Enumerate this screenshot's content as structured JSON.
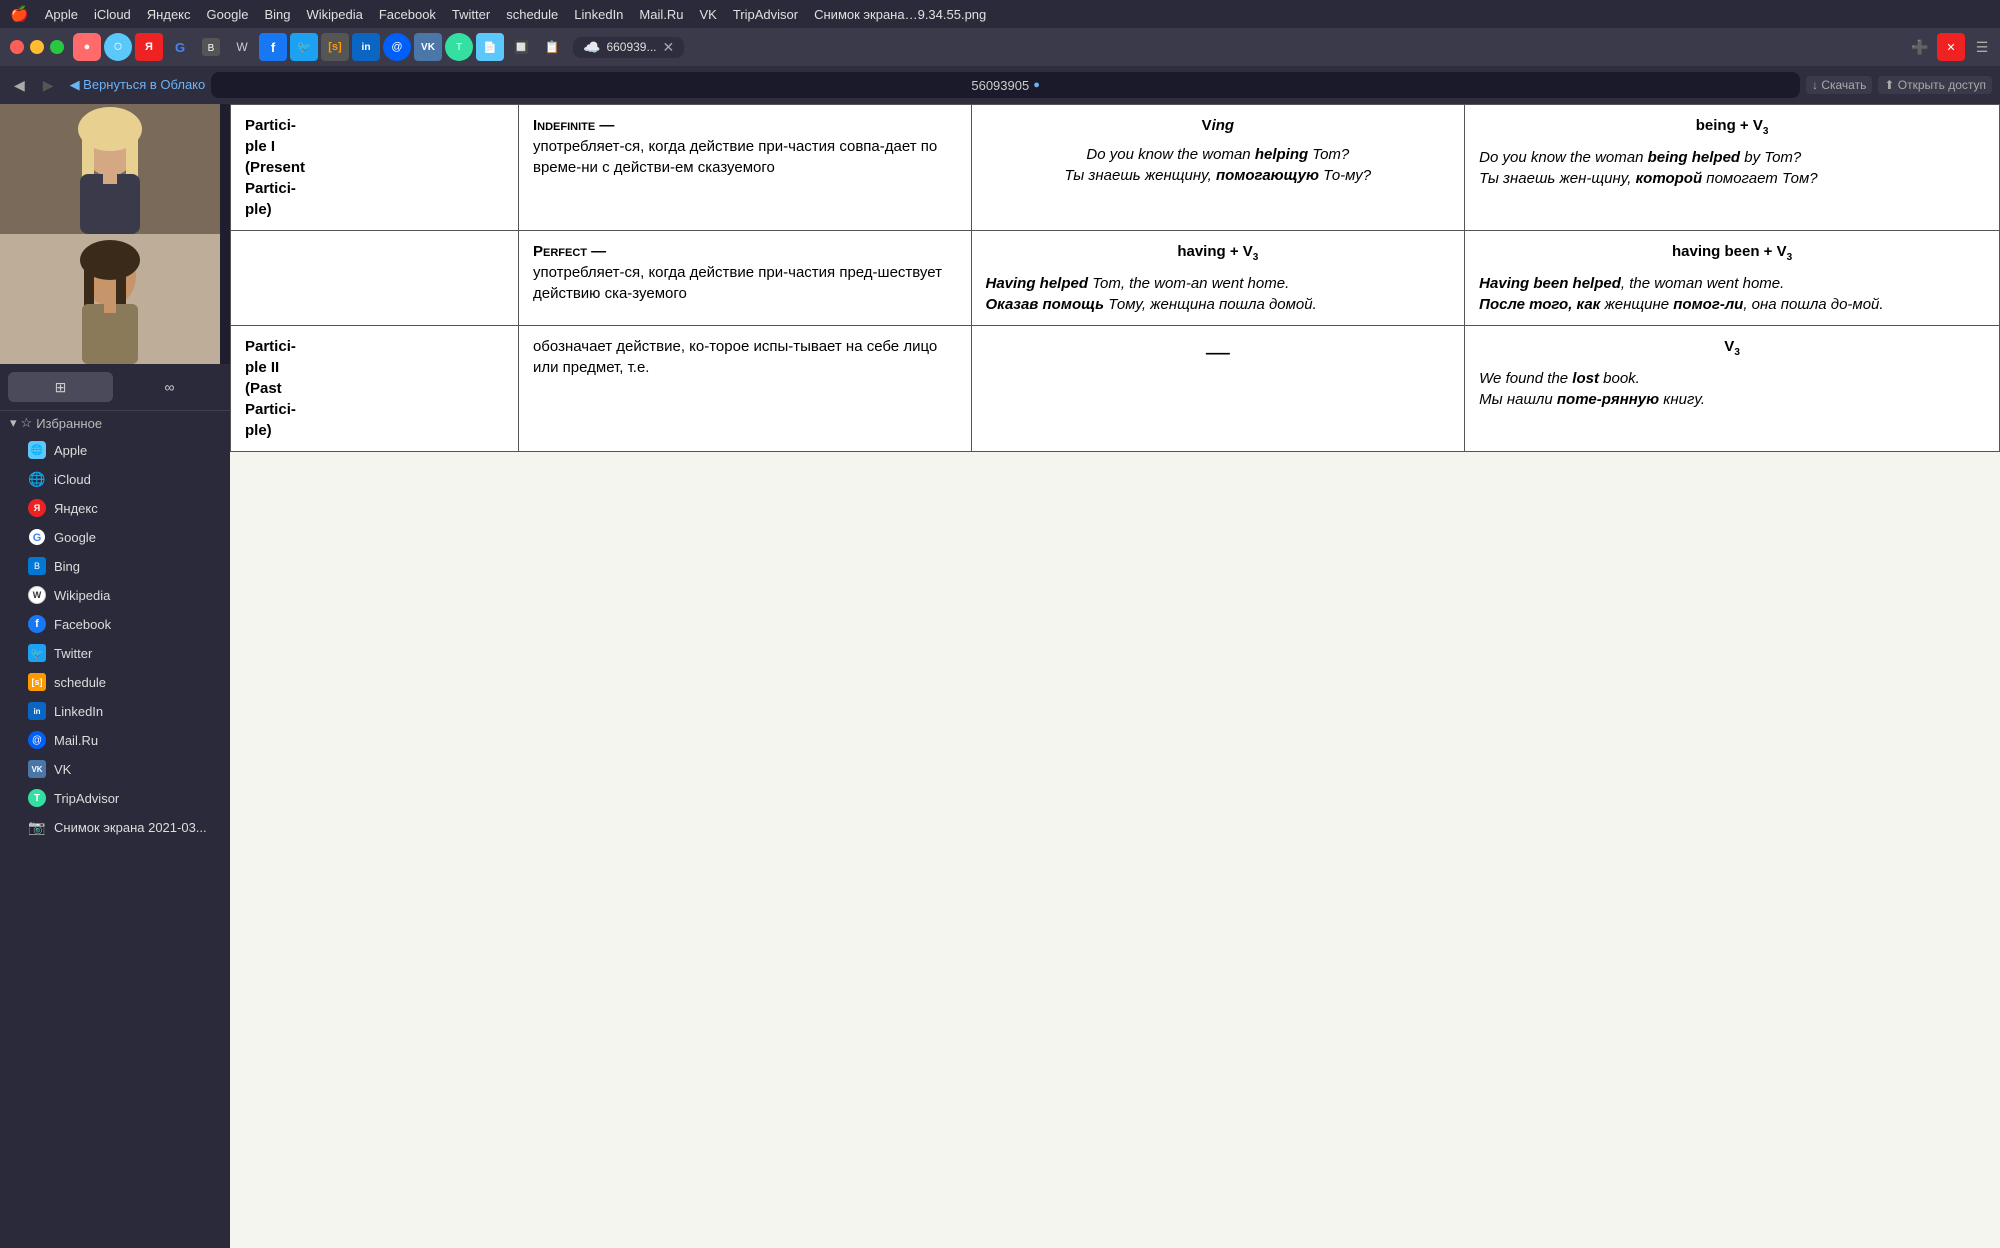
{
  "menubar": {
    "apple": "🍎",
    "items": [
      "Apple",
      "iCloud",
      "Яндекс",
      "Google",
      "Bing",
      "Wikipedia",
      "Facebook",
      "Twitter",
      "schedule",
      "LinkedIn",
      "Mail.Ru",
      "VK",
      "TripAdvisor",
      "Снимок экрана…9.34.55.png"
    ]
  },
  "toolbar": {
    "back_label": "◀ Вернуться в Облако",
    "title": "56093905",
    "tab_title": "660939...",
    "download_label": "↓ Скачать",
    "access_label": "⬆ Открыть доступ"
  },
  "sidebar": {
    "tab1_icon": "⊞",
    "tab2_icon": "∞",
    "section_label": "Избранное",
    "items": [
      {
        "label": "Apple",
        "icon": "🌐",
        "color": "#5ac8fa"
      },
      {
        "label": "iCloud",
        "icon": "🌐",
        "color": "#5ac8fa"
      },
      {
        "label": "Яндекс",
        "icon": "Я",
        "color": "#e22"
      },
      {
        "label": "Google",
        "icon": "G",
        "color": "#4285f4"
      },
      {
        "label": "Bing",
        "icon": "B",
        "color": "#0078d4"
      },
      {
        "label": "Wikipedia",
        "icon": "W",
        "color": "#ccc"
      },
      {
        "label": "Facebook",
        "icon": "f",
        "color": "#1877f2"
      },
      {
        "label": "Twitter",
        "icon": "t",
        "color": "#1da1f2"
      },
      {
        "label": "schedule",
        "icon": "S",
        "color": "#f90"
      },
      {
        "label": "LinkedIn",
        "icon": "in",
        "color": "#0a66c2"
      },
      {
        "label": "Mail.Ru",
        "icon": "@",
        "color": "#005ff9"
      },
      {
        "label": "VK",
        "icon": "VK",
        "color": "#4a76a8"
      },
      {
        "label": "TripAdvisor",
        "icon": "T",
        "color": "#34e0a1"
      },
      {
        "label": "Снимок экрана 2021-03...",
        "icon": "📷",
        "color": "#aaa"
      }
    ]
  },
  "table": {
    "rows": [
      {
        "col1": "Partici-ple I (Present Partici-ple)",
        "col2_prefix": "Indefinite —",
        "col2_text": "употребляет-ся, когда действие при-частия совпа-дает по вреᴍе-ни с действи-ем сказуемого",
        "col3_header": "Ving",
        "col3_text": "Do you know the woman helping Tom? Ты знаешь женщину, помогающую То-му?",
        "col4_header": "being + V₃",
        "col4_text": "Do you know the woman being helped by Tom? Ты знаешь жен-щину, которой помогает Том?"
      },
      {
        "col1": "",
        "col2_prefix": "Perfect —",
        "col2_text": "употребляет-ся, когда действие при-частия пред-шествует действию ска-зуемого",
        "col3_header": "having + V₃",
        "col3_text": "Having helped Tom, the woman went home. Оказав помощь Тому, женщина пошла домой.",
        "col4_header": "having been + V₃",
        "col4_text": "Having been helped, the woman went home. После того, как женщине помог-ли, она пошла до-мой."
      },
      {
        "col1": "Partici-ple II (Past Partici-ple)",
        "col2_prefix": "",
        "col2_text": "обозначает действие, ко-торое испы-тывает на себе лицо или предмет, т.е.",
        "col3_header": "—",
        "col3_text": "",
        "col4_header": "V₃",
        "col4_text": "We found the lost book. Мы нашли поте-рянную книгу."
      }
    ]
  }
}
